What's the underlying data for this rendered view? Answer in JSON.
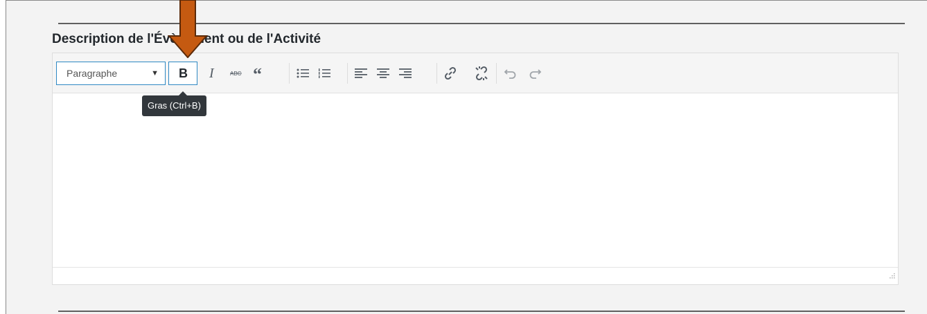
{
  "section": {
    "title": "Description de l'Évènement ou de l'Activité"
  },
  "editor": {
    "format_select": {
      "value": "Paragraphe"
    },
    "toolbar": [
      {
        "name": "bold-button",
        "icon": "bold-icon",
        "tooltip": "Gras (Ctrl+B)"
      },
      {
        "name": "italic-button",
        "icon": "italic-icon"
      },
      {
        "name": "strikethrough-button",
        "icon": "strikethrough-icon"
      },
      {
        "name": "blockquote-button",
        "icon": "blockquote-icon"
      },
      {
        "name": "bullet-list-button",
        "icon": "bullet-list-icon"
      },
      {
        "name": "numbered-list-button",
        "icon": "numbered-list-icon"
      },
      {
        "name": "align-left-button",
        "icon": "align-left-icon"
      },
      {
        "name": "align-center-button",
        "icon": "align-center-icon"
      },
      {
        "name": "align-right-button",
        "icon": "align-right-icon"
      },
      {
        "name": "insert-link-button",
        "icon": "link-icon"
      },
      {
        "name": "remove-link-button",
        "icon": "unlink-icon"
      },
      {
        "name": "undo-button",
        "icon": "undo-icon"
      },
      {
        "name": "redo-button",
        "icon": "redo-icon"
      }
    ],
    "tooltip": "Gras (Ctrl+B)"
  },
  "annotation": {
    "arrow_color": "#c55a11",
    "arrow_border": "#5b2a08",
    "accent": "#2e88c3"
  }
}
